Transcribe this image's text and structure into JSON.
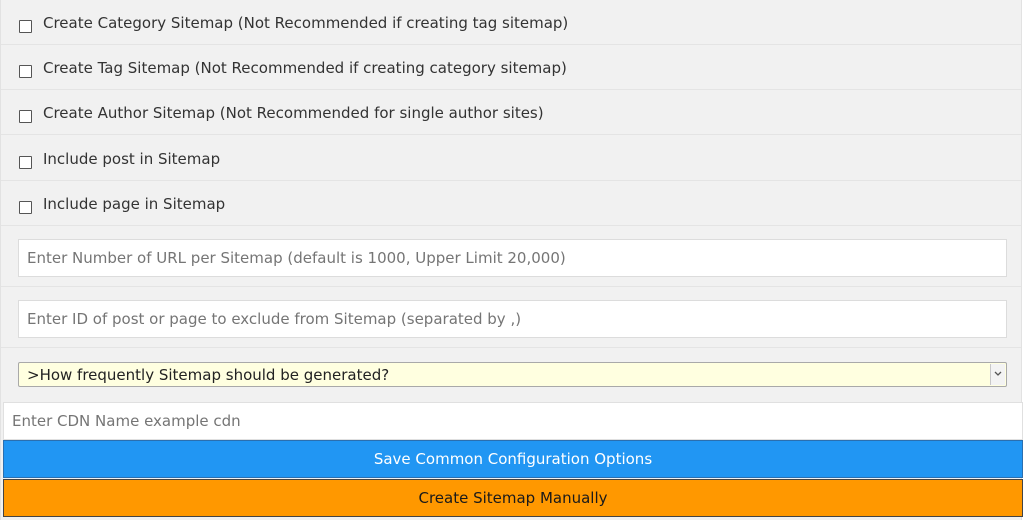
{
  "checkboxes": [
    {
      "label": "Create Category Sitemap (Not Recommended if creating tag sitemap)",
      "checked": false
    },
    {
      "label": "Create Tag Sitemap (Not Recommended if creating category sitemap)",
      "checked": false
    },
    {
      "label": "Create Author Sitemap (Not Recommended for single author sites)",
      "checked": false
    },
    {
      "label": "Include post in Sitemap",
      "checked": false
    },
    {
      "label": "Include page in Sitemap",
      "checked": false
    }
  ],
  "url_per_sitemap": {
    "value": "",
    "placeholder": "Enter Number of URL per Sitemap (default is 1000, Upper Limit 20,000)"
  },
  "exclude_ids": {
    "value": "",
    "placeholder": "Enter ID of post or page to exclude from Sitemap (separated by ,)"
  },
  "frequency_select": {
    "selected": ">How frequently Sitemap should be generated?",
    "icon": "chevron-down-icon"
  },
  "cdn_name": {
    "value": "",
    "placeholder": "Enter CDN Name example cdn"
  },
  "buttons": {
    "save_label": "Save Common Configuration Options",
    "create_label": "Create Sitemap Manually"
  },
  "colors": {
    "save_button": "#2196f3",
    "create_button": "#ff9800",
    "select_background": "#ffffe0",
    "panel_background": "#f1f1f1"
  }
}
